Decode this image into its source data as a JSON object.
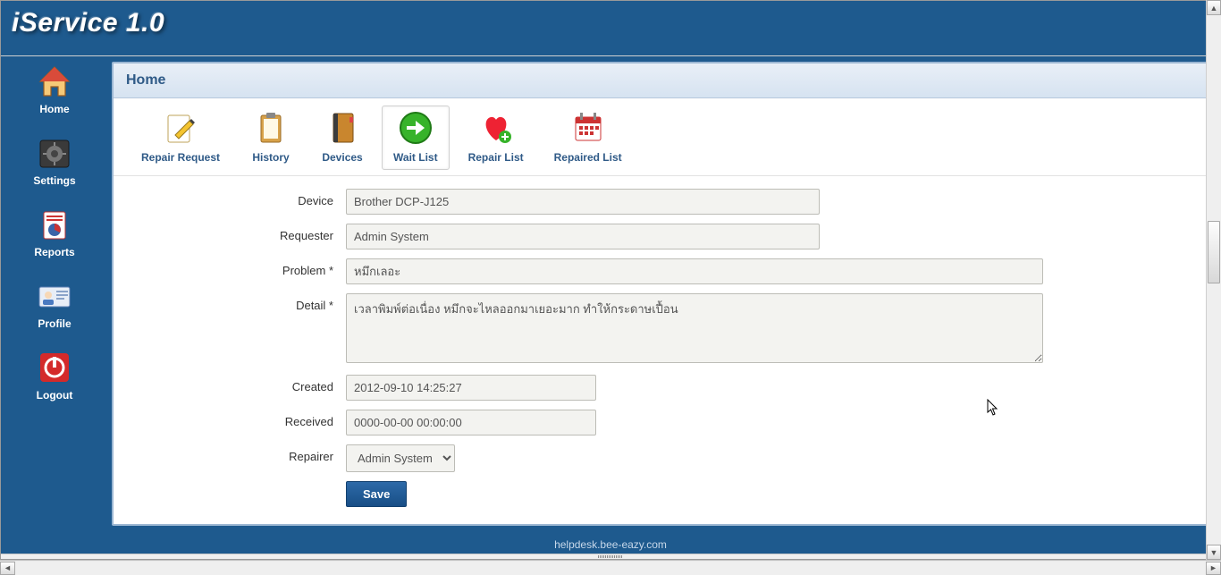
{
  "app": {
    "title": "iService 1.0"
  },
  "sidebar": {
    "items": [
      {
        "label": "Home"
      },
      {
        "label": "Settings"
      },
      {
        "label": "Reports"
      },
      {
        "label": "Profile"
      },
      {
        "label": "Logout"
      }
    ]
  },
  "panel": {
    "title": "Home"
  },
  "toolbar": {
    "items": [
      {
        "label": "Repair Request"
      },
      {
        "label": "History"
      },
      {
        "label": "Devices"
      },
      {
        "label": "Wait List"
      },
      {
        "label": "Repair List"
      },
      {
        "label": "Repaired List"
      }
    ],
    "active_index": 3
  },
  "form": {
    "labels": {
      "device": "Device",
      "requester": "Requester",
      "problem": "Problem *",
      "detail": "Detail *",
      "created": "Created",
      "received": "Received",
      "repairer": "Repairer"
    },
    "values": {
      "device": "Brother DCP-J125",
      "requester": "Admin System",
      "problem": "หมึกเลอะ",
      "detail": "เวลาพิมพ์ต่อเนื่อง หมึกจะไหลออกมาเยอะมาก ทำให้กระดาษเปื้อน",
      "created": "2012-09-10 14:25:27",
      "received": "0000-00-00 00:00:00",
      "repairer_selected": "Admin System"
    },
    "save_label": "Save"
  },
  "footer": {
    "text": "helpdesk.bee-eazy.com"
  }
}
